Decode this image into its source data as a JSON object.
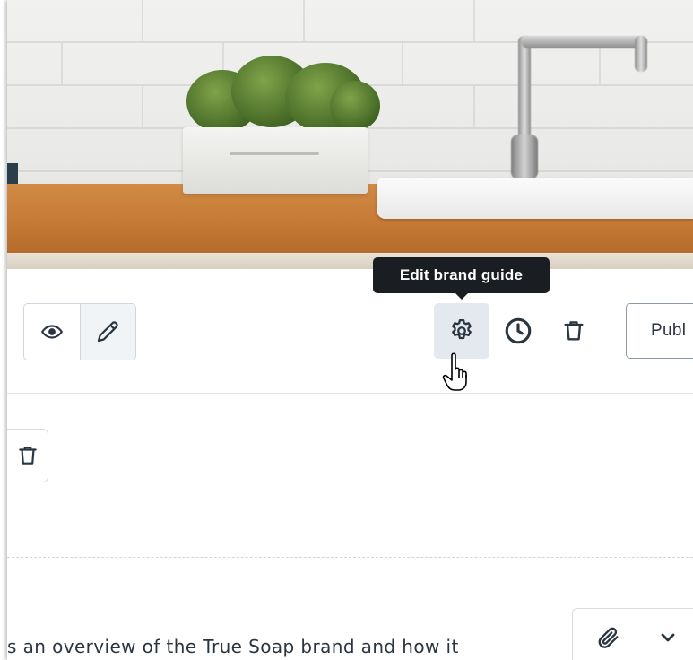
{
  "hero_image": {
    "description": "kitchen-sink-photo"
  },
  "toolbar": {
    "view_icon": "eye-icon",
    "edit_icon": "pencil-icon",
    "settings_icon": "gear-icon",
    "history_icon": "clock-icon",
    "delete_icon": "trash-icon",
    "publish_label": "Publ",
    "tooltip_text": "Edit brand guide"
  },
  "section": {
    "delete_icon": "trash-icon"
  },
  "editor": {
    "attach_icon": "paperclip-icon",
    "expand_icon": "chevron-down-icon",
    "body_text": "s an overview of the True Soap brand and how it"
  },
  "colors": {
    "tooltip_bg": "#1a1d21",
    "active_button_bg": "#e4e9ef",
    "text": "#2b3540",
    "border": "#cfd6dd"
  }
}
